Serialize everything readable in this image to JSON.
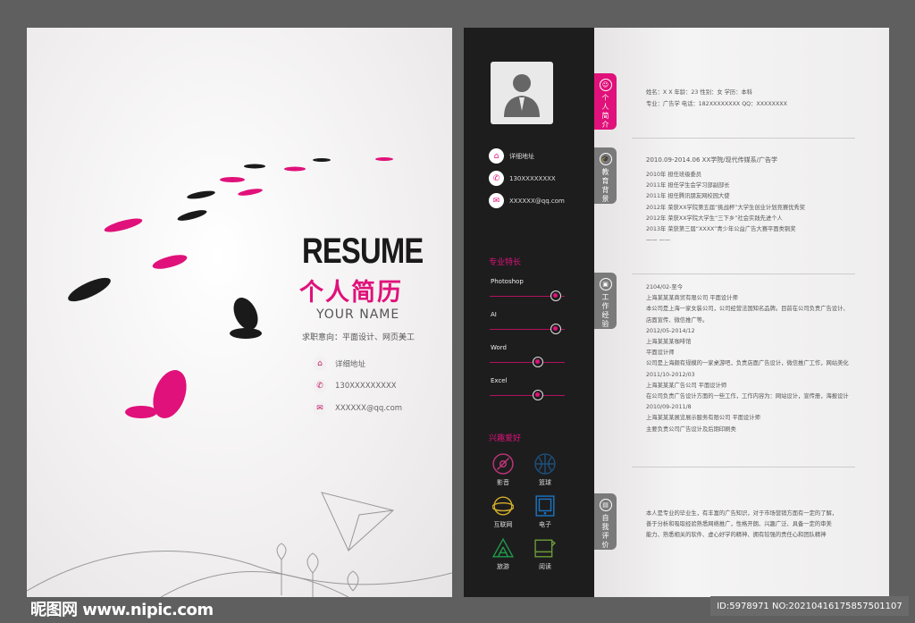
{
  "cover": {
    "resume": "RESUME",
    "title_cn": "个人简历",
    "name": "YOUR NAME",
    "intent": "求职意向：平面设计、网页美工",
    "contacts": [
      {
        "icon": "home-icon",
        "text": "详细地址"
      },
      {
        "icon": "phone-icon",
        "text": "130XXXXXXXXX"
      },
      {
        "icon": "mail-icon",
        "text": "XXXXXX@qq.com"
      }
    ]
  },
  "sidebar": {
    "contacts": [
      {
        "icon": "home-icon",
        "text": "详细地址"
      },
      {
        "icon": "phone-icon",
        "text": "130XXXXXXXX"
      },
      {
        "icon": "mail-icon",
        "text": "XXXXXX@qq.com"
      }
    ],
    "skills_title": "专业特长",
    "skills": [
      {
        "name": "Photoshop",
        "level": 0.88
      },
      {
        "name": "AI",
        "level": 0.88
      },
      {
        "name": "Word",
        "level": 0.64
      },
      {
        "name": "Excel",
        "level": 0.64
      }
    ],
    "hobbies_title": "兴趣爱好",
    "hobbies": [
      {
        "label": "影音",
        "icon": "disc-icon",
        "color": "#c0367a"
      },
      {
        "label": "篮球",
        "icon": "basketball-icon",
        "color": "#1d4f7a"
      },
      {
        "label": "互联网",
        "icon": "globe-icon",
        "color": "#d4b02a"
      },
      {
        "label": "电子",
        "icon": "tablet-icon",
        "color": "#1a74c0"
      },
      {
        "label": "旅游",
        "icon": "tent-icon",
        "color": "#1f9a4a"
      },
      {
        "label": "阅读",
        "icon": "book-icon",
        "color": "#6a9a3a"
      }
    ]
  },
  "tabs": [
    {
      "label": "个人简介",
      "icon": "person-icon",
      "active": true
    },
    {
      "label": "教育背景",
      "icon": "graduation-cap-icon"
    },
    {
      "label": "工作经验",
      "icon": "briefcase-icon"
    },
    {
      "label": "自我评价",
      "icon": "note-icon"
    }
  ],
  "profile": {
    "line1": "姓名：X X      年龄：23      性别：女      学历：本科",
    "line2": "专业：广告学    电话：182XXXXXXXX      QQ：XXXXXXXX"
  },
  "education": {
    "header": "2010.09-2014.06      XX学院/现代传媒系/广告学",
    "items": [
      "2010年    担任班级委员",
      "2011年    担任学生会学习部副部长",
      "2011年    担任腾讯朋友网校园大使",
      "2012年    荣获XX学院第五届“挑战杯”大学生创业计划竞赛优秀奖",
      "2012年    荣获XX学院大学生“三下乡”社会实践先进个人",
      "2013年    荣获第三届“XXXX”青少年公益广告大赛平面类铜奖",
      "—— ——"
    ]
  },
  "work": [
    "2104/02-至今",
    "上海某某某商贸有限公司    平面设计师",
    "本公司是上海一家女装公司，公司经营法国知名品牌。目前在公司负责广告设计、",
    "店面宣传、微信推广等。",
    "2012/05-2014/12",
    "上海某某某咖啡馆",
    "平面设计师",
    "公司是上海颇有规模的一家桌游吧，负责店面广告设计，微信推广工作，网站美化",
    "2011/10-2012/03",
    "上海某某某广告公司    平面设计师",
    "在公司负责广告设计方面的一些工作，工作内容为：网站设计，宣传册，海报设计",
    "2010/09-2011/8",
    "上海某某某展览展示服务有限公司  平面设计师",
    "主要负责公司广告设计及后期印刷类"
  ],
  "self_eval": [
    "本人是专业的毕业生，有丰富的广告知识，对于市场营销方面有一定的了解，",
    "善于分析和吸取经验熟悉网络推广，性格开朗、兴趣广泛、具备一定的审美",
    "能力、熟悉相关的软件、虚心好学的精神、拥有较强的责任心和团队精神"
  ],
  "watermark": {
    "site": "昵图网 www.nipic.com",
    "id": "ID:5978971 NO:20210416175857501107"
  },
  "colors": {
    "accent": "#e0117a",
    "dark": "#1e1d1e"
  }
}
